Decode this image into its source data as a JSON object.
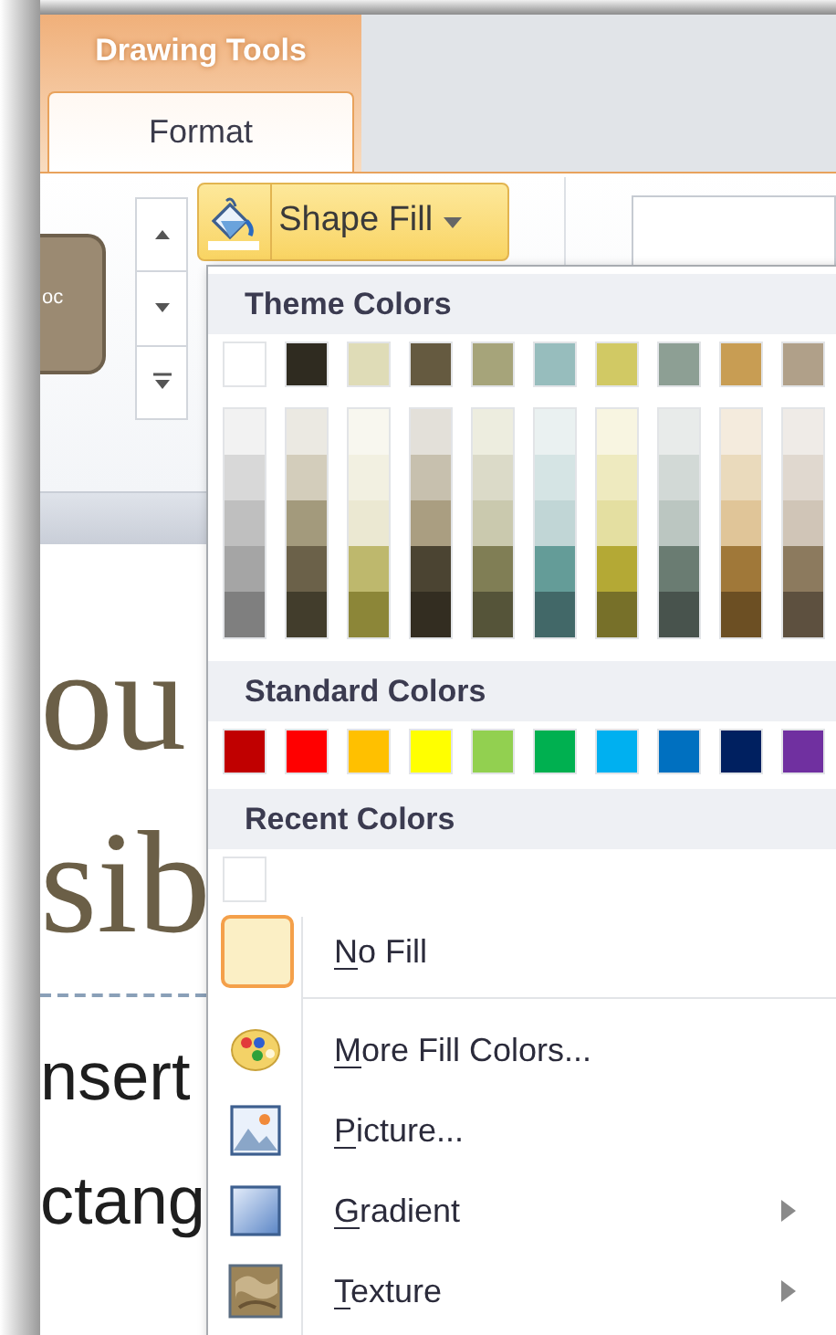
{
  "contextual_tab_group": {
    "label": "Drawing Tools"
  },
  "tabs": [
    {
      "label": "Format",
      "selected": true
    }
  ],
  "ribbon": {
    "gallery_thumbnail": {
      "label": "oc"
    },
    "shape_fill_button": {
      "label": "Shape Fill",
      "pressed": true
    }
  },
  "document": {
    "lines": [
      {
        "kind": "title",
        "text": "ou"
      },
      {
        "kind": "title",
        "text": "sib"
      },
      {
        "kind": "rule"
      },
      {
        "kind": "body",
        "text": "nsert"
      },
      {
        "kind": "body",
        "text": "ctang"
      }
    ]
  },
  "menu": {
    "sections": [
      {
        "header": "Theme Colors",
        "colors": [
          {
            "color": "#ffffff"
          },
          {
            "color": "#2f2b20"
          },
          {
            "color": "#dfdcb7"
          },
          {
            "color": "#655a40"
          },
          {
            "color": "#a6a47a"
          },
          {
            "color": "#97bdbd"
          },
          {
            "color": "#d1c964"
          },
          {
            "color": "#8d9f94"
          },
          {
            "color": "#c89d53"
          },
          {
            "color": "#b0a089"
          }
        ],
        "shades": [
          [
            {
              "color": "#f2f2f2"
            },
            {
              "color": "#d8d8d8"
            },
            {
              "color": "#bfbfbf"
            },
            {
              "color": "#a5a5a5"
            },
            {
              "color": "#7f7f7f"
            }
          ],
          [
            {
              "color": "#ebe9e2"
            },
            {
              "color": "#d3cdbb"
            },
            {
              "color": "#a39a7c"
            },
            {
              "color": "#6b6149"
            },
            {
              "color": "#423d2c"
            }
          ],
          [
            {
              "color": "#f8f7ef"
            },
            {
              "color": "#f2f0e1"
            },
            {
              "color": "#ebe8d2"
            },
            {
              "color": "#beb86d"
            },
            {
              "color": "#8c8638"
            }
          ],
          [
            {
              "color": "#e3e0d9"
            },
            {
              "color": "#c7c0ae"
            },
            {
              "color": "#aa9e81"
            },
            {
              "color": "#4b4432"
            },
            {
              "color": "#332d21"
            }
          ],
          [
            {
              "color": "#ededdf"
            },
            {
              "color": "#dbdac8"
            },
            {
              "color": "#cac9ae"
            },
            {
              "color": "#807e55"
            },
            {
              "color": "#555439"
            }
          ],
          [
            {
              "color": "#eaf1f1"
            },
            {
              "color": "#d5e4e4"
            },
            {
              "color": "#c1d6d6"
            },
            {
              "color": "#649c98"
            },
            {
              "color": "#426868"
            }
          ],
          [
            {
              "color": "#f8f5e1"
            },
            {
              "color": "#eeeabf"
            },
            {
              "color": "#e4dfa1"
            },
            {
              "color": "#b4a935"
            },
            {
              "color": "#777029"
            }
          ],
          [
            {
              "color": "#e8ebea"
            },
            {
              "color": "#d2d9d6"
            },
            {
              "color": "#bbc6c1"
            },
            {
              "color": "#6a7c72"
            },
            {
              "color": "#48534d"
            }
          ],
          [
            {
              "color": "#f4ebdd"
            },
            {
              "color": "#eadabc"
            },
            {
              "color": "#e0c598"
            },
            {
              "color": "#a07839"
            },
            {
              "color": "#6c4f23"
            }
          ],
          [
            {
              "color": "#efebe7"
            },
            {
              "color": "#e0d8cf"
            },
            {
              "color": "#d0c5b7"
            },
            {
              "color": "#8c7a5e"
            },
            {
              "color": "#5d503f"
            }
          ]
        ]
      },
      {
        "header": "Standard Colors",
        "colors": [
          {
            "color": "#c00000"
          },
          {
            "color": "#ff0000"
          },
          {
            "color": "#ffc000"
          },
          {
            "color": "#ffff00"
          },
          {
            "color": "#92d050"
          },
          {
            "color": "#00b050"
          },
          {
            "color": "#00b0f0"
          },
          {
            "color": "#0070c0"
          },
          {
            "color": "#002060"
          },
          {
            "color": "#7030a0"
          }
        ]
      },
      {
        "header": "Recent Colors",
        "colors": [
          {
            "color": "#ffffff"
          }
        ]
      }
    ],
    "no_fill": {
      "label": "No Fill",
      "underline_first": true,
      "selected": true
    },
    "items": [
      {
        "label": "More Fill Colors...",
        "underline_first": true,
        "kind": "palette",
        "submenu": false
      },
      {
        "label": "Picture...",
        "underline_first": true,
        "kind": "picture",
        "submenu": false
      },
      {
        "label": "Gradient",
        "underline_first": true,
        "kind": "gradient",
        "submenu": true
      },
      {
        "label": "Texture",
        "underline_first": true,
        "kind": "texture",
        "submenu": true
      }
    ]
  }
}
